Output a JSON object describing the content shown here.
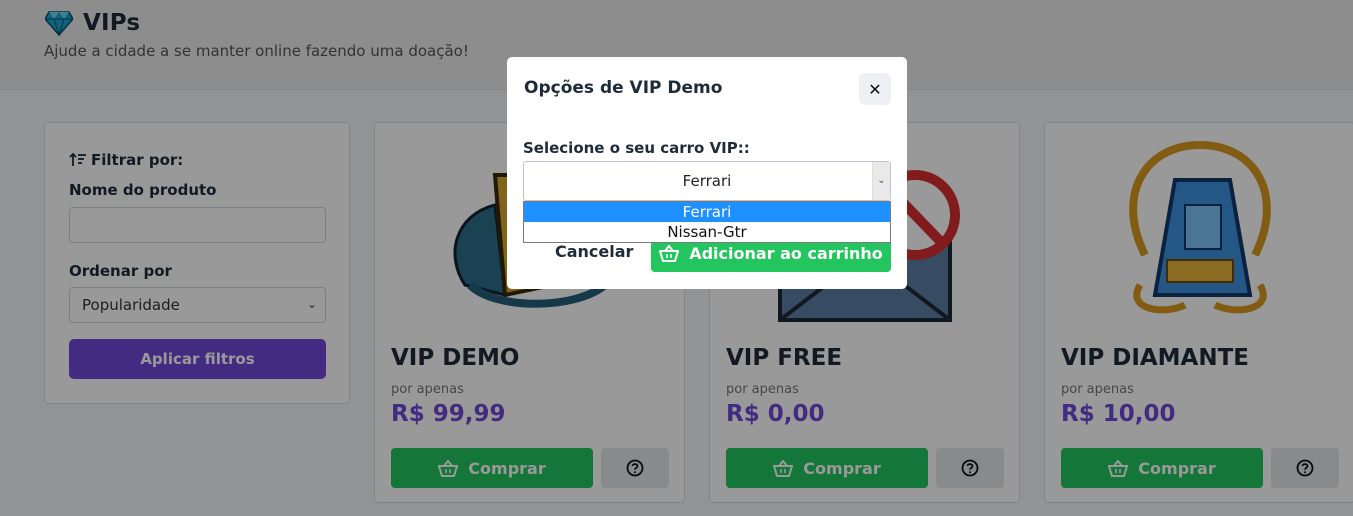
{
  "header": {
    "title": "VIPs",
    "subtitle": "Ajude a cidade a se manter online fazendo uma doação!"
  },
  "filters": {
    "title": "Filtrar por:",
    "name_label": "Nome do produto",
    "name_value": "",
    "order_label": "Ordenar por",
    "order_selected": "Popularidade",
    "apply_label": "Aplicar filtros"
  },
  "products": [
    {
      "name": "VIP DEMO",
      "price_prefix": "por apenas",
      "price": "R$ 99,99",
      "buy_label": "Comprar"
    },
    {
      "name": "VIP FREE",
      "price_prefix": "por apenas",
      "price": "R$ 0,00",
      "buy_label": "Comprar"
    },
    {
      "name": "VIP DIAMANTE",
      "price_prefix": "por apenas",
      "price": "R$ 10,00",
      "buy_label": "Comprar"
    }
  ],
  "modal": {
    "title": "Opções de VIP Demo",
    "select_label": "Selecione o seu carro VIP::",
    "selected_car": "Ferrari",
    "options": [
      "Ferrari",
      "Nissan-Gtr"
    ],
    "cancel_label": "Cancelar",
    "add_label": "Adicionar ao carrinho"
  },
  "colors": {
    "brand_purple": "#7049d8",
    "buy_green": "#22c55e",
    "dropdown_highlight": "#1e90ff"
  },
  "icons": {
    "header": "diamond-icon",
    "filter": "sort-filter-icon",
    "buy": "basket-icon",
    "help": "question-circle-icon",
    "close": "close-icon"
  }
}
